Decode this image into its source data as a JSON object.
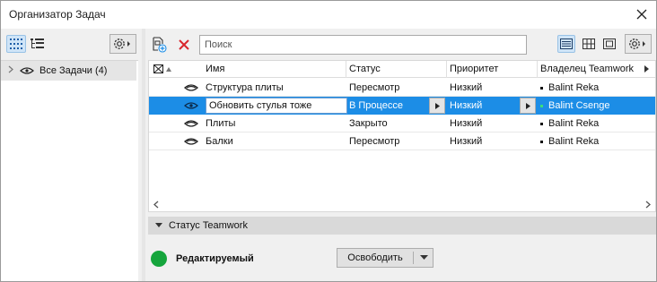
{
  "window": {
    "title": "Организатор Задач"
  },
  "left_panel": {
    "tree": [
      {
        "label": "Все Задачи (4)"
      }
    ]
  },
  "toolbar": {
    "search_placeholder": "Поиск"
  },
  "table": {
    "columns": [
      "Имя",
      "Статус",
      "Приоритет",
      "Владелец Teamwork"
    ],
    "rows": [
      {
        "name": "Структура плиты",
        "status": "Пересмотр",
        "priority": "Низкий",
        "owner": "Balint Reka"
      },
      {
        "name": "Обновить стулья тоже",
        "status": "В Процессе",
        "priority": "Низкий",
        "owner": "Balint Csenge"
      },
      {
        "name": "Плиты",
        "status": "Закрыто",
        "priority": "Низкий",
        "owner": "Balint Reka"
      },
      {
        "name": "Балки",
        "status": "Пересмотр",
        "priority": "Низкий",
        "owner": "Balint Reka"
      }
    ]
  },
  "teamwork": {
    "section_label": "Статус Teamwork",
    "status_label": "Редактируемый",
    "status_color": "#15a53c",
    "release_label": "Освободить"
  },
  "colors": {
    "selection": "#1c8de6",
    "accent": "#1c8de6",
    "delete_icon": "#d9262c"
  }
}
